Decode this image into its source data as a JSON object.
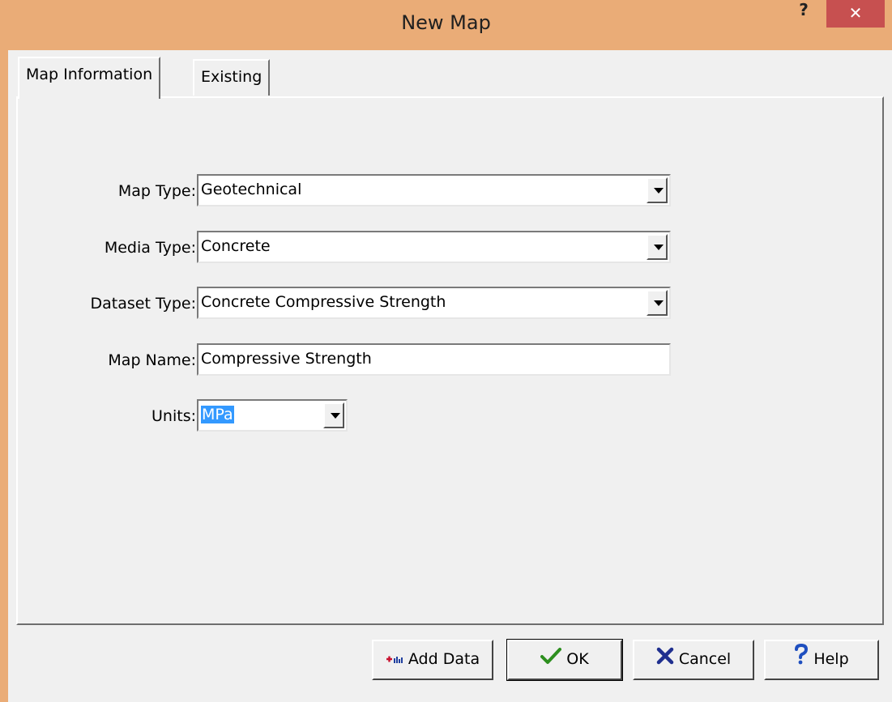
{
  "window": {
    "title": "New Map"
  },
  "tabs": [
    {
      "label": "Map Information"
    },
    {
      "label": "Existing"
    }
  ],
  "form": {
    "map_type": {
      "label": "Map Type:",
      "value": "Geotechnical"
    },
    "media_type": {
      "label": "Media Type:",
      "value": "Concrete"
    },
    "dataset_type": {
      "label": "Dataset Type:",
      "value": "Concrete Compressive Strength"
    },
    "map_name": {
      "label": "Map Name:",
      "value": "Compressive Strength"
    },
    "units": {
      "label": "Units:",
      "value": "MPa"
    }
  },
  "buttons": {
    "add_data": "Add Data",
    "ok": "OK",
    "cancel": "Cancel",
    "help": "Help"
  },
  "title_help_glyph": "?",
  "title_close_glyph": "✕",
  "colors": {
    "frame": "#eaac77",
    "close": "#c75050",
    "selection": "#3399ff"
  }
}
